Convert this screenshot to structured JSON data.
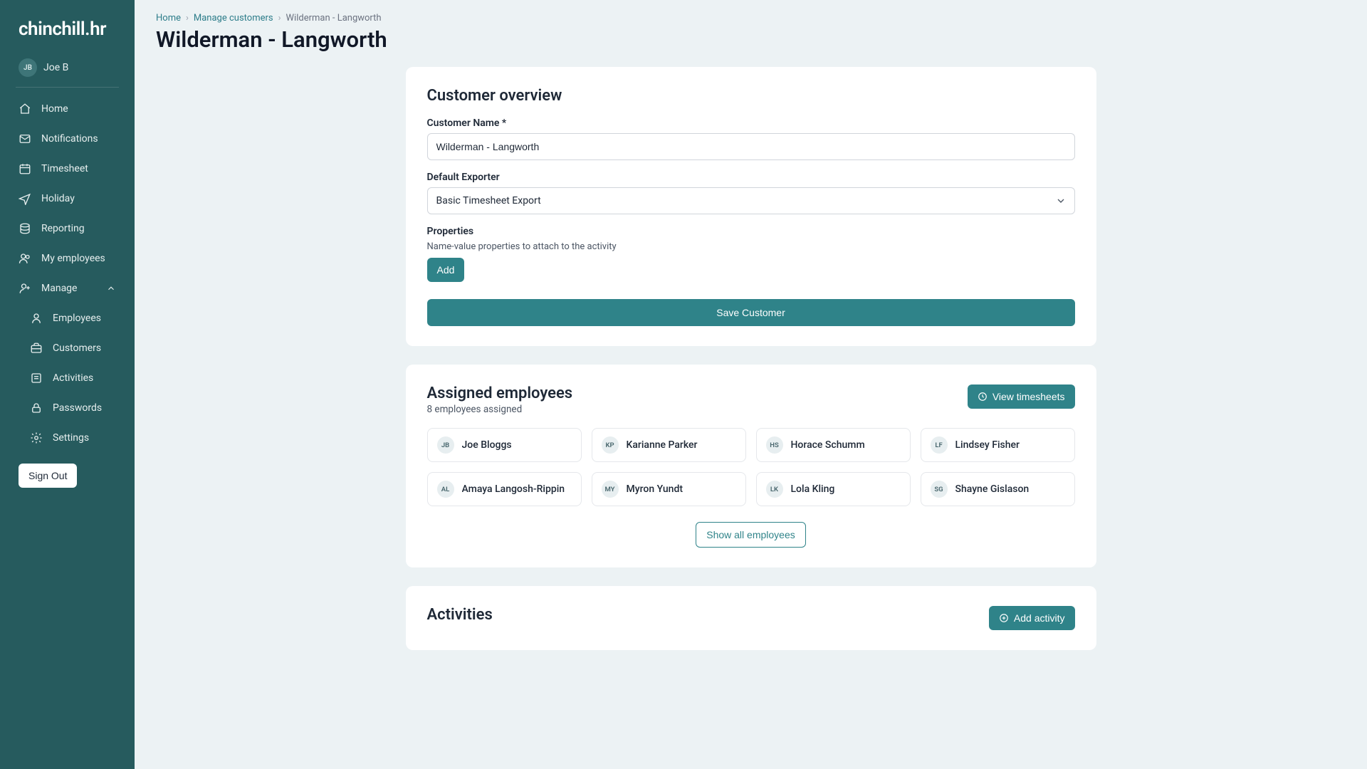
{
  "brand": "chinchill.hr",
  "user": {
    "initials": "JB",
    "name": "Joe B"
  },
  "sidebar": {
    "items": [
      {
        "label": "Home",
        "icon": "home-icon"
      },
      {
        "label": "Notifications",
        "icon": "mail-icon"
      },
      {
        "label": "Timesheet",
        "icon": "calendar-icon"
      },
      {
        "label": "Holiday",
        "icon": "plane-icon"
      },
      {
        "label": "Reporting",
        "icon": "database-icon"
      },
      {
        "label": "My employees",
        "icon": "users-icon"
      },
      {
        "label": "Manage",
        "icon": "user-plus-icon",
        "expanded": true
      }
    ],
    "manage_children": [
      {
        "label": "Employees",
        "icon": "user-icon"
      },
      {
        "label": "Customers",
        "icon": "briefcase-icon"
      },
      {
        "label": "Activities",
        "icon": "activity-icon"
      },
      {
        "label": "Passwords",
        "icon": "lock-icon"
      },
      {
        "label": "Settings",
        "icon": "gear-icon"
      }
    ],
    "signout": "Sign Out"
  },
  "breadcrumb": {
    "items": [
      "Home",
      "Manage customers",
      "Wilderman - Langworth"
    ]
  },
  "page_title": "Wilderman - Langworth",
  "overview": {
    "title": "Customer overview",
    "name_label": "Customer Name *",
    "name_value": "Wilderman - Langworth",
    "exporter_label": "Default Exporter",
    "exporter_value": "Basic Timesheet Export",
    "properties_label": "Properties",
    "properties_desc": "Name-value properties to attach to the activity",
    "add_label": "Add",
    "save_label": "Save Customer"
  },
  "employees": {
    "title": "Assigned employees",
    "subtitle": "8 employees assigned",
    "view_timesheets": "View timesheets",
    "list": [
      {
        "initials": "JB",
        "name": "Joe Bloggs"
      },
      {
        "initials": "KP",
        "name": "Karianne Parker"
      },
      {
        "initials": "HS",
        "name": "Horace Schumm"
      },
      {
        "initials": "LF",
        "name": "Lindsey Fisher"
      },
      {
        "initials": "AL",
        "name": "Amaya Langosh-Rippin"
      },
      {
        "initials": "MY",
        "name": "Myron Yundt"
      },
      {
        "initials": "LK",
        "name": "Lola Kling"
      },
      {
        "initials": "SG",
        "name": "Shayne Gislason"
      }
    ],
    "show_all": "Show all employees"
  },
  "activities": {
    "title": "Activities",
    "add_label": "Add activity"
  }
}
